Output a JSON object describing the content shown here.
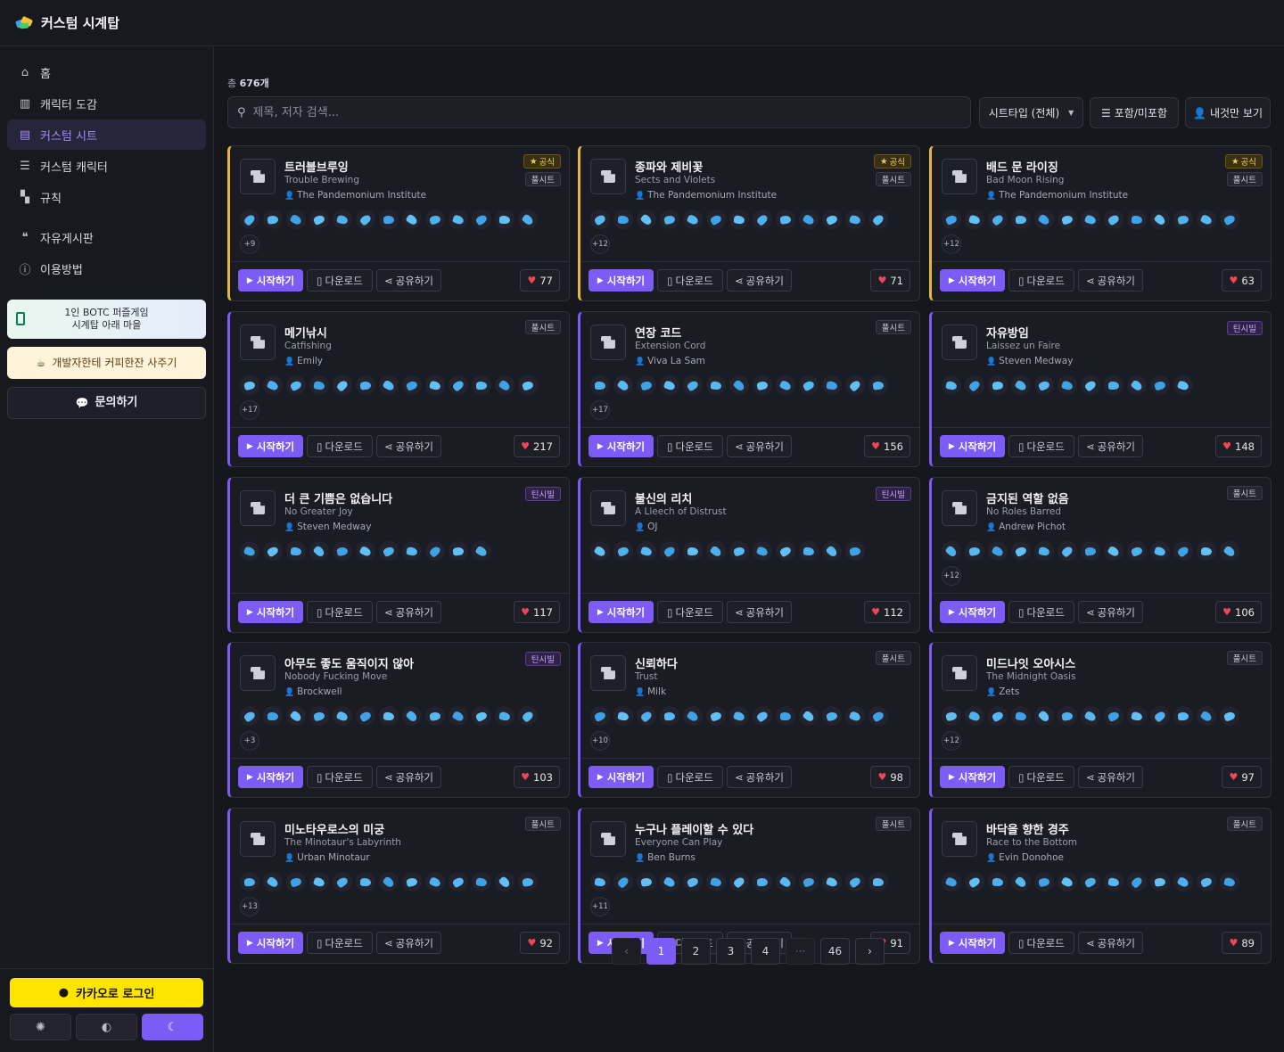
{
  "app": {
    "title": "커스텀 시계탑"
  },
  "sidebar": {
    "items": [
      {
        "label": "홈",
        "icon": "home-icon"
      },
      {
        "label": "캐릭터 도감",
        "icon": "book-icon"
      },
      {
        "label": "커스텀 시트",
        "icon": "document-icon",
        "active": true
      },
      {
        "label": "커스텀 캐릭터",
        "icon": "list-icon"
      },
      {
        "label": "규칙",
        "icon": "scroll-icon"
      }
    ],
    "items2": [
      {
        "label": "자유게시판",
        "icon": "chat-icon"
      },
      {
        "label": "이용방법",
        "icon": "info-icon"
      }
    ],
    "promo_line1": "1인 BOTC 퍼즐게임",
    "promo_line2": "시계탑 아래 마을",
    "coffee": "개발자한테 커피한잔 사주기",
    "contact": "문의하기",
    "kakao_login": "카카오로 로그인"
  },
  "toolbar": {
    "total_prefix": "총",
    "total_count": "676개",
    "search_placeholder": "제목, 저자 검색...",
    "sheet_type": "시트타입 (전체)",
    "include_exclude": "포함/미포함",
    "mine_only": "내것만 보기"
  },
  "card_labels": {
    "start": "시작하기",
    "download": "다운로드",
    "share": "공유하기"
  },
  "badges": {
    "official": "공식",
    "full": "풀시트",
    "teen": "틴시빌"
  },
  "colors": {
    "accent": "#7c5cf5",
    "official": "#e2b93b",
    "like": "#f0465a",
    "icon": "#4fb0ee"
  },
  "cards": [
    {
      "title": "트러블브루잉",
      "en": "Trouble Brewing",
      "author": "The Pandemonium Institute",
      "official": true,
      "type": "full",
      "icons": 13,
      "more": "+9",
      "likes": "77"
    },
    {
      "title": "종파와 제비꽃",
      "en": "Sects and Violets",
      "author": "The Pandemonium Institute",
      "official": true,
      "type": "full",
      "icons": 13,
      "more": "+12",
      "likes": "71"
    },
    {
      "title": "배드 문 라이징",
      "en": "Bad Moon Rising",
      "author": "The Pandemonium Institute",
      "official": true,
      "type": "full",
      "icons": 13,
      "more": "+12",
      "likes": "63"
    },
    {
      "title": "메기낚시",
      "en": "Catfishing",
      "author": "Emily",
      "official": false,
      "type": "full",
      "icons": 13,
      "more": "+17",
      "likes": "217"
    },
    {
      "title": "연장 코드",
      "en": "Extension Cord",
      "author": "Viva La Sam",
      "official": false,
      "type": "full",
      "icons": 13,
      "more": "+17",
      "likes": "156"
    },
    {
      "title": "자유방임",
      "en": "Laissez un Faire",
      "author": "Steven Medway",
      "official": false,
      "type": "teen",
      "icons": 11,
      "more": "",
      "likes": "148"
    },
    {
      "title": "더 큰 기쁨은 없습니다",
      "en": "No Greater Joy",
      "author": "Steven Medway",
      "official": false,
      "type": "teen",
      "icons": 11,
      "more": "",
      "likes": "117"
    },
    {
      "title": "불신의 리치",
      "en": "A Lleech of Distrust",
      "author": "OJ",
      "official": false,
      "type": "teen",
      "icons": 12,
      "more": "",
      "likes": "112"
    },
    {
      "title": "금지된 역할 없음",
      "en": "No Roles Barred",
      "author": "Andrew Pichot",
      "official": false,
      "type": "full",
      "icons": 13,
      "more": "+12",
      "likes": "106"
    },
    {
      "title": "아무도 좋도 움직이지 않아",
      "en": "Nobody Fucking Move",
      "author": "Brockwell",
      "official": false,
      "type": "teen",
      "icons": 13,
      "more": "+3",
      "likes": "103"
    },
    {
      "title": "신뢰하다",
      "en": "Trust",
      "author": "Milk",
      "official": false,
      "type": "full",
      "icons": 13,
      "more": "+10",
      "likes": "98"
    },
    {
      "title": "미드나잇 오아시스",
      "en": "The Midnight Oasis",
      "author": "Zets",
      "official": false,
      "type": "full",
      "icons": 13,
      "more": "+12",
      "likes": "97"
    },
    {
      "title": "미노타우로스의 미궁",
      "en": "The Minotaur's Labyrinth",
      "author": "Urban Minotaur",
      "official": false,
      "type": "full",
      "icons": 13,
      "more": "+13",
      "likes": "92"
    },
    {
      "title": "누구나 플레이할 수 있다",
      "en": "Everyone Can Play",
      "author": "Ben Burns",
      "official": false,
      "type": "full",
      "icons": 13,
      "more": "+11",
      "likes": "91"
    },
    {
      "title": "바닥을 향한 경주",
      "en": "Race to the Bottom",
      "author": "Evin Donohoe",
      "official": false,
      "type": "full",
      "icons": 13,
      "more": "",
      "likes": "89"
    }
  ],
  "pagination": {
    "pages": [
      "1",
      "2",
      "3",
      "4"
    ],
    "ellipsis": "···",
    "last": "46",
    "current": "1"
  }
}
